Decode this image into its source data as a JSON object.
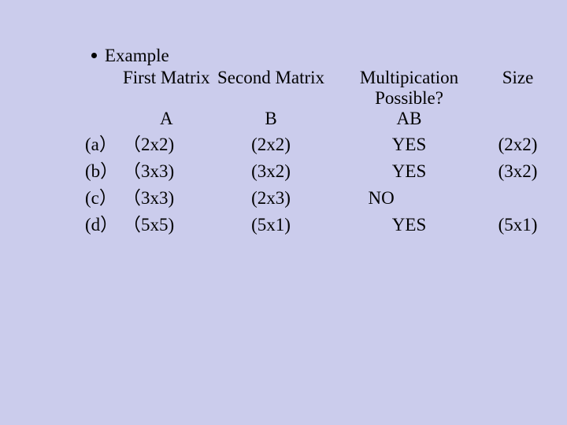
{
  "bullet": "Example",
  "headers": {
    "first": "First Matrix",
    "second": "Second Matrix",
    "mult1": "Multipication",
    "mult2": "Possible?",
    "size": "Size",
    "a": "A",
    "b": "B",
    "ab": "AB"
  },
  "rows": [
    {
      "label": "(a）",
      "a": "（2x2)",
      "b": "(2x2)",
      "ab": "YES",
      "size": "(2x2)"
    },
    {
      "label": "(b）",
      "a": "（3x3)",
      "b": "(3x2)",
      "ab": "YES",
      "size": "(3x2)"
    },
    {
      "label": "(c）",
      "a": "（3x3)",
      "b": "(2x3)",
      "ab": "NO",
      "size": ""
    },
    {
      "label": "(d）",
      "a": "（5x5)",
      "b": "(5x1)",
      "ab": "YES",
      "size": "(5x1)"
    }
  ]
}
